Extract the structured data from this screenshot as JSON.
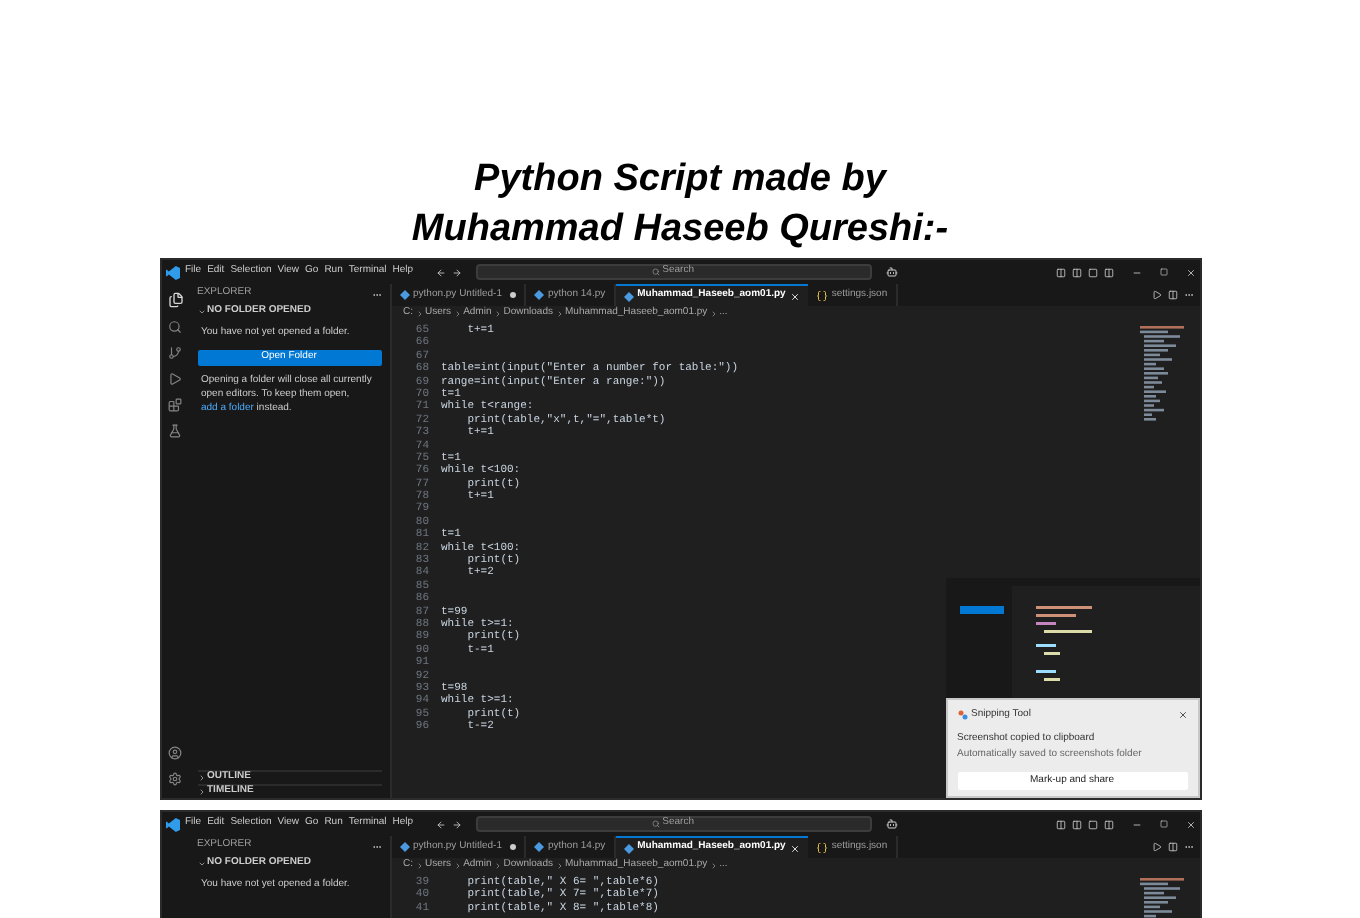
{
  "title_lines": [
    "Python Script made by",
    "Muhammad Haseeb Qureshi:-"
  ],
  "screenshots": [
    {
      "menu": [
        "File",
        "Edit",
        "Selection",
        "View",
        "Go",
        "Run",
        "Terminal",
        "Help"
      ],
      "search": {
        "placeholder": "Search"
      },
      "sidebar": {
        "title": "EXPLORER",
        "section": "NO FOLDER OPENED",
        "message": "You have not yet opened a folder.",
        "button": "Open Folder",
        "note": "Opening a folder will close all currently open editors. To keep them open, ",
        "note_link": "add a folder",
        "note_end": " instead.",
        "panels": [
          "OUTLINE",
          "TIMELINE"
        ]
      },
      "tabs": [
        {
          "label": "python.py Untitled-1",
          "selected": false,
          "dirty": true,
          "kind": "python"
        },
        {
          "label": "python 14.py",
          "selected": false,
          "dirty": false,
          "kind": "python"
        },
        {
          "label": "Muhammad_Haseeb_aom01.py",
          "selected": true,
          "dirty": false,
          "kind": "python"
        },
        {
          "label": "settings.json",
          "selected": false,
          "dirty": false,
          "kind": "json"
        }
      ],
      "breadcrumb": [
        "C:",
        "Users",
        "Admin",
        "Downloads",
        "Muhammad_Haseeb_aom01.py",
        "..."
      ],
      "code": [
        {
          "number": "65",
          "text": "    t+=1"
        },
        {
          "number": "66"
        },
        {
          "number": "67"
        },
        {
          "number": "68",
          "text": "table=int(input(\"Enter a number for table:\"))"
        },
        {
          "number": "69",
          "text": "range=int(input(\"Enter a range:\"))"
        },
        {
          "number": "70",
          "text": "t=1"
        },
        {
          "number": "71",
          "text": "while t<range:"
        },
        {
          "number": "72",
          "text": "    print(table,\"x\",t,\"=\",table*t)"
        },
        {
          "number": "73",
          "text": "    t+=1"
        },
        {
          "number": "74"
        },
        {
          "number": "75",
          "text": "t=1"
        },
        {
          "number": "76",
          "text": "while t<100:"
        },
        {
          "number": "77",
          "text": "    print(t)"
        },
        {
          "number": "78",
          "text": "    t+=1"
        },
        {
          "number": "79"
        },
        {
          "number": "80"
        },
        {
          "number": "81",
          "text": "t=1"
        },
        {
          "number": "82",
          "text": "while t<100:"
        },
        {
          "number": "83",
          "text": "    print(t)"
        },
        {
          "number": "84",
          "text": "    t+=2"
        },
        {
          "number": "85"
        },
        {
          "number": "86"
        },
        {
          "number": "87",
          "text": "t=99"
        },
        {
          "number": "88",
          "text": "while t>=1:"
        },
        {
          "number": "89",
          "text": "    print(t)"
        },
        {
          "number": "90",
          "text": "    t-=1"
        },
        {
          "number": "91"
        },
        {
          "number": "92"
        },
        {
          "number": "93",
          "text": "t=98"
        },
        {
          "number": "94",
          "text": "while t>=1:"
        },
        {
          "number": "95",
          "text": "    print(t)"
        },
        {
          "number": "96",
          "text": "    t-=2"
        }
      ],
      "notification": {
        "app": "Snipping Tool",
        "title": "Screenshot copied to clipboard",
        "body": "Automatically saved to screenshots folder",
        "action": "Mark-up and share"
      }
    },
    {
      "menu": [
        "File",
        "Edit",
        "Selection",
        "View",
        "Go",
        "Run",
        "Terminal",
        "Help"
      ],
      "search": {
        "placeholder": "Search"
      },
      "sidebar": {
        "title": "EXPLORER",
        "section": "NO FOLDER OPENED",
        "message": "You have not yet opened a folder."
      },
      "tabs": [
        {
          "label": "python.py Untitled-1",
          "selected": false,
          "dirty": true,
          "kind": "python"
        },
        {
          "label": "python 14.py",
          "selected": false,
          "dirty": false,
          "kind": "python"
        },
        {
          "label": "Muhammad_Haseeb_aom01.py",
          "selected": true,
          "dirty": false,
          "kind": "python"
        },
        {
          "label": "settings.json",
          "selected": false,
          "dirty": false,
          "kind": "json"
        }
      ],
      "breadcrumb": [
        "C:",
        "Users",
        "Admin",
        "Downloads",
        "Muhammad_Haseeb_aom01.py",
        "..."
      ],
      "code": [
        {
          "number": "39",
          "text": "    print(table,\" X 6= \",table*6)"
        },
        {
          "number": "40",
          "text": "    print(table,\" X 7= \",table*7)"
        },
        {
          "number": "41",
          "text": "    print(table,\" X 8= \",table*8)"
        }
      ]
    }
  ]
}
